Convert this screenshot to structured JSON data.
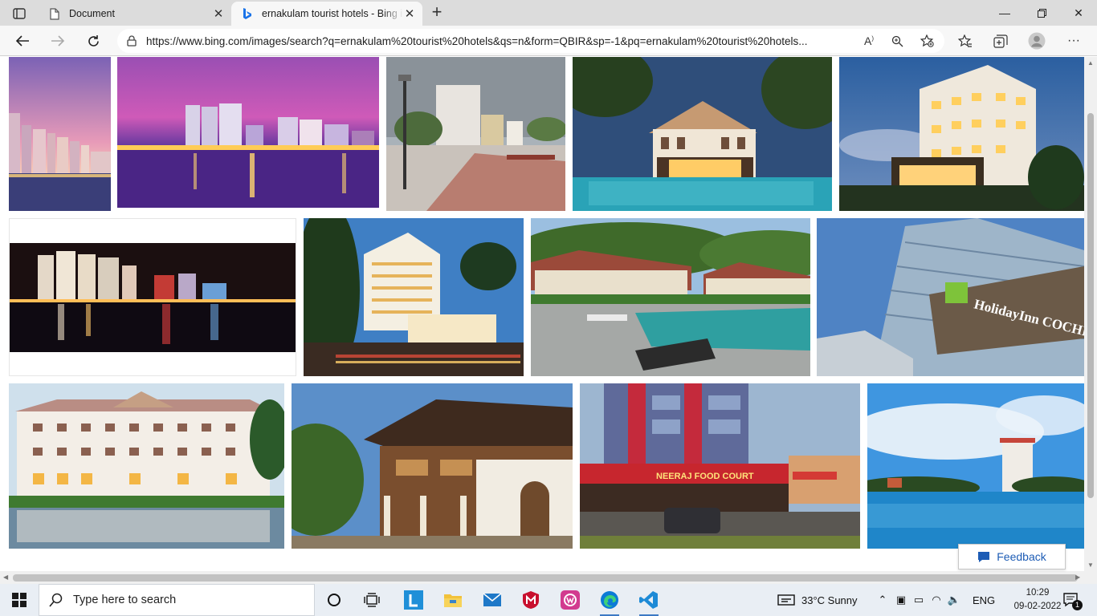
{
  "browser": {
    "tabs": [
      {
        "title": "Document",
        "icon": "document-icon",
        "active": false
      },
      {
        "title": "ernakulam tourist hotels - Bing images",
        "icon": "bing-icon",
        "active": true
      }
    ],
    "url": "https://www.bing.com/images/search?q=ernakulam%20tourist%20hotels&qs=n&form=QBIR&sp=-1&pq=ernakulam%20tourist%20hotels..."
  },
  "results": {
    "images": [
      {
        "subject": "city skyline at dusk"
      },
      {
        "subject": "waterfront buildings reflected at night"
      },
      {
        "subject": "marine drive walkway with apartments"
      },
      {
        "subject": "heritage resort with pool"
      },
      {
        "subject": "lit hotel building at dusk"
      },
      {
        "subject": "night skyline with reflections"
      },
      {
        "subject": "hotel tower with palm trees"
      },
      {
        "subject": "resort cottages with pool"
      },
      {
        "subject": "Holiday Inn Cochin building",
        "signage": "HolidayInn COCHIN"
      },
      {
        "subject": "white heritage hotel with pond"
      },
      {
        "subject": "traditional Kerala-style building"
      },
      {
        "subject": "street with food court building",
        "signage": "NEERAJ FOOD COURT"
      },
      {
        "subject": "backwater view with high-rise"
      }
    ],
    "feedback_label": "Feedback"
  },
  "taskbar": {
    "search_placeholder": "Type here to search",
    "weather": "33°C  Sunny",
    "language": "ENG",
    "time": "10:29",
    "date": "09-02-2022",
    "notification_count": "1"
  },
  "colors": {
    "accent": "#0078d4",
    "taskbar": "#e9eef4",
    "tabstrip": "#dcdcdc"
  }
}
